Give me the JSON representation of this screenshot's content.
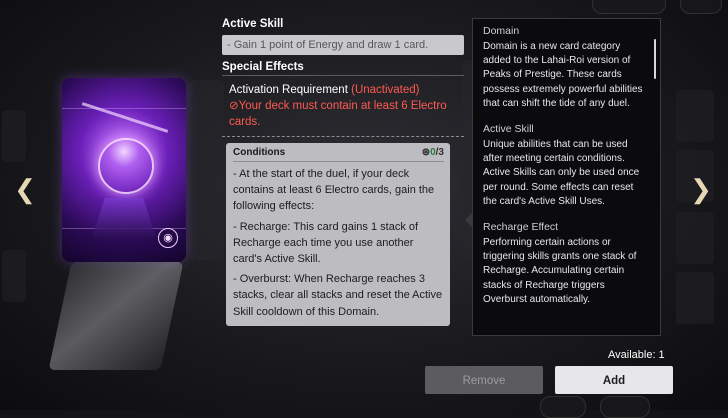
{
  "detail": {
    "active_skill_title": "Active Skill",
    "active_skill_text": "- Gain 1 point of Energy and draw 1 card.",
    "special_effects_title": "Special Effects",
    "activation_label": "Activation Requirement",
    "activation_status": "(Unactivated)",
    "warning": "⊘Your deck must contain at least 6 Electro cards.",
    "conditions": {
      "title": "Conditions",
      "count_current": "0",
      "count_total": "/3",
      "lines": [
        "- At the start of the duel, if your deck contains at least 6 Electro cards, gain the following effects:",
        "- Recharge: This card gains 1 stack of Recharge each time you use another card's Active Skill.",
        "- Overburst: When Recharge reaches 3 stacks, clear all stacks and reset the Active Skill cooldown of this Domain."
      ]
    }
  },
  "tooltip": {
    "sections": [
      {
        "title": "Domain",
        "text": "Domain is a new card category added to the Lahai-Roi version of Peaks of Prestige. These cards possess extremely powerful abilities that can shift the tide of any duel."
      },
      {
        "title": "Active Skill",
        "text": "Unique abilities that can be used after meeting certain conditions. Active Skills can only be used once per round. Some effects can reset the card's Active Skill Uses."
      },
      {
        "title": "Recharge Effect",
        "text": "Performing certain actions or triggering skills grants one stack of Recharge. Accumulating certain stacks of Recharge triggers Overburst automatically."
      }
    ]
  },
  "footer": {
    "available": "Available: 1",
    "remove_label": "Remove",
    "add_label": "Add"
  },
  "colors": {
    "accent_red": "#ff5a50",
    "card_purple": "#6a1fb8",
    "progress_green": "#2a7c3a"
  },
  "icons": {
    "prev": "chevron-left-icon",
    "next": "chevron-right-icon",
    "card_badge": "domain-badge-icon",
    "conditions": "conditions-icon"
  }
}
